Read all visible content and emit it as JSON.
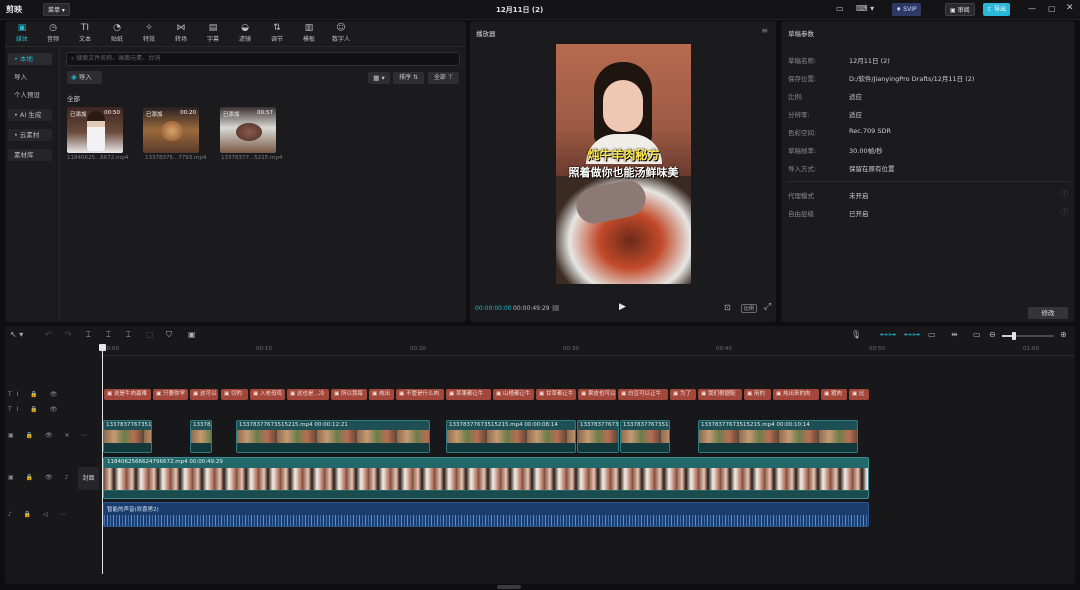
{
  "app": {
    "logo": "剪映",
    "menu_label": "菜单",
    "title": "12月11日 (2)",
    "svip": "SVIP",
    "review": "审阅",
    "export": "导出"
  },
  "toolbar": {
    "items": [
      "媒体",
      "音频",
      "文本",
      "贴纸",
      "特效",
      "转场",
      "字幕",
      "滤镜",
      "调节",
      "模板",
      "数字人"
    ]
  },
  "sidebar": {
    "items": [
      "• 本地",
      "导入",
      "个人预设",
      "• AI 生成",
      "• 云素材",
      "素材库"
    ]
  },
  "media": {
    "search_placeholder": "搜索文件名称、画面元素、台词",
    "import_label": "导入",
    "sort_label": "排序",
    "filter_label": "全部",
    "section_label": "全部",
    "items": [
      {
        "badge": "已添加",
        "duration": "00:50",
        "name": "11840625...6672.mp4"
      },
      {
        "badge": "已添加",
        "duration": "00:20",
        "name": "13378375...7793.mp4"
      },
      {
        "badge": "已添加",
        "duration": "00:57",
        "name": "13378377...5215.mp4"
      }
    ]
  },
  "player": {
    "title": "播放器",
    "caption_line1": "炖牛羊肉秘方",
    "caption_line2": "照着做你也能汤鲜味美",
    "current_time": "00:00:00:00",
    "total_time": "00:00:49:29",
    "ratio_label": "比例"
  },
  "draft": {
    "title": "草稿参数",
    "rows": [
      {
        "label": "草稿名称:",
        "value": "12月11日 (2)"
      },
      {
        "label": "保存位置:",
        "value": "D:/软件/JianyingPro Drafts/12月11日 (2)"
      },
      {
        "label": "比例:",
        "value": "适应"
      },
      {
        "label": "分辨率:",
        "value": "适应"
      },
      {
        "label": "色彩空间:",
        "value": "Rec.709 SDR"
      },
      {
        "label": "草稿帧率:",
        "value": "30.00帧/秒"
      },
      {
        "label": "导入方式:",
        "value": "保留在原有位置"
      },
      {
        "label": "代理模式",
        "value": "未开启"
      },
      {
        "label": "自由层级",
        "value": "已开启"
      }
    ],
    "modify_label": "修改"
  },
  "timeline": {
    "ruler": [
      "00:00",
      "00:10",
      "00:20",
      "00:30",
      "00:40",
      "00:50",
      "01:00"
    ],
    "text_clips": [
      "说是牛肉最难",
      "只要你学",
      "这可以",
      "切的",
      "入老母鸡",
      "这也是…冷",
      "所以我每",
      "炖出",
      "不管是什么肉",
      "草果都让牛",
      "山楂都让牛",
      "甘草都让牛",
      "果皮也可以",
      "白豆可以让牛",
      "为了",
      "我们根据配",
      "用的",
      "炖出来的肉",
      "猪肉",
      "比"
    ],
    "broll_clips": [
      {
        "name": "13378377673515",
        "duration": ""
      },
      {
        "name": "1337837",
        "duration": ""
      },
      {
        "name": "13378377673515215.mp4",
        "duration": "00:00:12:21"
      },
      {
        "name": "13378377673515215.mp4",
        "duration": "00:00:08:14"
      },
      {
        "name": "13378377673515",
        "duration": ""
      },
      {
        "name": "13378377673515",
        "duration": ""
      },
      {
        "name": "13378377673515215.mp4",
        "duration": "00:00:10:14"
      }
    ],
    "main_clip": {
      "name": "1184062566624796672.mp4",
      "duration": "00:00:49:29"
    },
    "cover_label": "封面",
    "audio_clip": "智能的声音(欢喜男2)"
  },
  "colors": {
    "accent": "#1fb8c9",
    "export": "#2bb7d8",
    "text_clip": "#a4473b",
    "main_clip": "#22686b",
    "audio": "#1b3d6d"
  }
}
